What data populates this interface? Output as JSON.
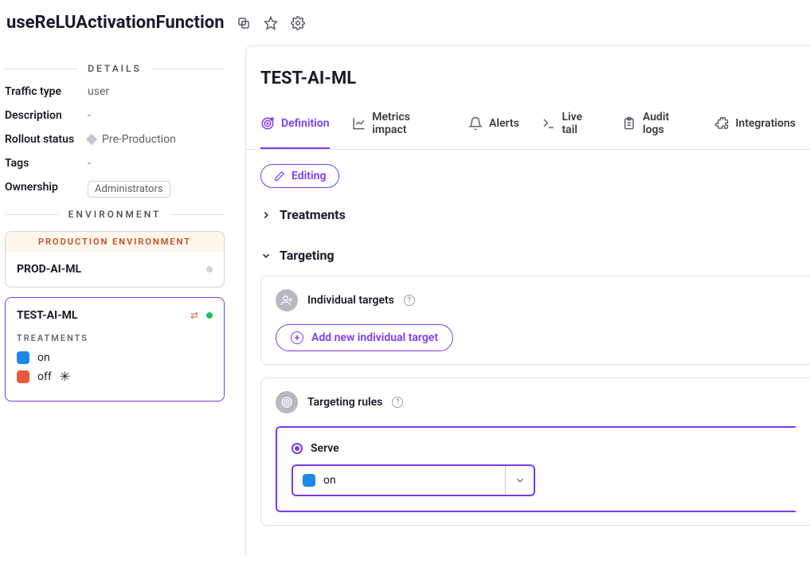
{
  "header": {
    "title": "useReLUActivationFunction"
  },
  "details": {
    "heading": "DETAILS",
    "rows": {
      "traffic_type_label": "Traffic type",
      "traffic_type_value": "user",
      "description_label": "Description",
      "description_value": "-",
      "rollout_label": "Rollout status",
      "rollout_value": "Pre-Production",
      "tags_label": "Tags",
      "tags_value": "-",
      "ownership_label": "Ownership",
      "ownership_value": "Administrators"
    }
  },
  "environment": {
    "heading": "ENVIRONMENT",
    "prod_banner": "PRODUCTION ENVIRONMENT",
    "items": [
      {
        "name": "PROD-AI-ML",
        "active": false
      },
      {
        "name": "TEST-AI-ML",
        "active": true
      }
    ],
    "treatments_heading": "TREATMENTS",
    "treatments": [
      {
        "name": "on",
        "color": "#1e88e5"
      },
      {
        "name": "off",
        "color": "#e85a3b",
        "default": true
      }
    ]
  },
  "main": {
    "title": "TEST-AI-ML",
    "tabs": {
      "definition": "Definition",
      "metrics": "Metrics impact",
      "alerts": "Alerts",
      "livetail": "Live tail",
      "audit": "Audit logs",
      "integrations": "Integrations"
    },
    "editing_label": "Editing",
    "sections": {
      "treatments": "Treatments",
      "targeting": "Targeting"
    },
    "individual_targets": {
      "title": "Individual targets",
      "add_button": "Add new individual target"
    },
    "targeting_rules": {
      "title": "Targeting rules",
      "serve_label": "Serve",
      "serve_value": "on"
    }
  }
}
